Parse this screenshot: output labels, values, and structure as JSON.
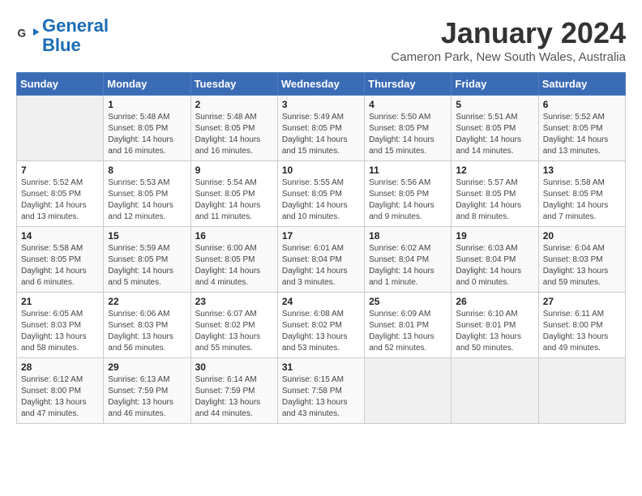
{
  "header": {
    "logo_line1": "General",
    "logo_line2": "Blue",
    "month": "January 2024",
    "location": "Cameron Park, New South Wales, Australia"
  },
  "weekdays": [
    "Sunday",
    "Monday",
    "Tuesday",
    "Wednesday",
    "Thursday",
    "Friday",
    "Saturday"
  ],
  "weeks": [
    [
      {
        "day": "",
        "info": ""
      },
      {
        "day": "1",
        "info": "Sunrise: 5:48 AM\nSunset: 8:05 PM\nDaylight: 14 hours\nand 16 minutes."
      },
      {
        "day": "2",
        "info": "Sunrise: 5:48 AM\nSunset: 8:05 PM\nDaylight: 14 hours\nand 16 minutes."
      },
      {
        "day": "3",
        "info": "Sunrise: 5:49 AM\nSunset: 8:05 PM\nDaylight: 14 hours\nand 15 minutes."
      },
      {
        "day": "4",
        "info": "Sunrise: 5:50 AM\nSunset: 8:05 PM\nDaylight: 14 hours\nand 15 minutes."
      },
      {
        "day": "5",
        "info": "Sunrise: 5:51 AM\nSunset: 8:05 PM\nDaylight: 14 hours\nand 14 minutes."
      },
      {
        "day": "6",
        "info": "Sunrise: 5:52 AM\nSunset: 8:05 PM\nDaylight: 14 hours\nand 13 minutes."
      }
    ],
    [
      {
        "day": "7",
        "info": "Sunrise: 5:52 AM\nSunset: 8:05 PM\nDaylight: 14 hours\nand 13 minutes."
      },
      {
        "day": "8",
        "info": "Sunrise: 5:53 AM\nSunset: 8:05 PM\nDaylight: 14 hours\nand 12 minutes."
      },
      {
        "day": "9",
        "info": "Sunrise: 5:54 AM\nSunset: 8:05 PM\nDaylight: 14 hours\nand 11 minutes."
      },
      {
        "day": "10",
        "info": "Sunrise: 5:55 AM\nSunset: 8:05 PM\nDaylight: 14 hours\nand 10 minutes."
      },
      {
        "day": "11",
        "info": "Sunrise: 5:56 AM\nSunset: 8:05 PM\nDaylight: 14 hours\nand 9 minutes."
      },
      {
        "day": "12",
        "info": "Sunrise: 5:57 AM\nSunset: 8:05 PM\nDaylight: 14 hours\nand 8 minutes."
      },
      {
        "day": "13",
        "info": "Sunrise: 5:58 AM\nSunset: 8:05 PM\nDaylight: 14 hours\nand 7 minutes."
      }
    ],
    [
      {
        "day": "14",
        "info": "Sunrise: 5:58 AM\nSunset: 8:05 PM\nDaylight: 14 hours\nand 6 minutes."
      },
      {
        "day": "15",
        "info": "Sunrise: 5:59 AM\nSunset: 8:05 PM\nDaylight: 14 hours\nand 5 minutes."
      },
      {
        "day": "16",
        "info": "Sunrise: 6:00 AM\nSunset: 8:05 PM\nDaylight: 14 hours\nand 4 minutes."
      },
      {
        "day": "17",
        "info": "Sunrise: 6:01 AM\nSunset: 8:04 PM\nDaylight: 14 hours\nand 3 minutes."
      },
      {
        "day": "18",
        "info": "Sunrise: 6:02 AM\nSunset: 8:04 PM\nDaylight: 14 hours\nand 1 minute."
      },
      {
        "day": "19",
        "info": "Sunrise: 6:03 AM\nSunset: 8:04 PM\nDaylight: 14 hours\nand 0 minutes."
      },
      {
        "day": "20",
        "info": "Sunrise: 6:04 AM\nSunset: 8:03 PM\nDaylight: 13 hours\nand 59 minutes."
      }
    ],
    [
      {
        "day": "21",
        "info": "Sunrise: 6:05 AM\nSunset: 8:03 PM\nDaylight: 13 hours\nand 58 minutes."
      },
      {
        "day": "22",
        "info": "Sunrise: 6:06 AM\nSunset: 8:03 PM\nDaylight: 13 hours\nand 56 minutes."
      },
      {
        "day": "23",
        "info": "Sunrise: 6:07 AM\nSunset: 8:02 PM\nDaylight: 13 hours\nand 55 minutes."
      },
      {
        "day": "24",
        "info": "Sunrise: 6:08 AM\nSunset: 8:02 PM\nDaylight: 13 hours\nand 53 minutes."
      },
      {
        "day": "25",
        "info": "Sunrise: 6:09 AM\nSunset: 8:01 PM\nDaylight: 13 hours\nand 52 minutes."
      },
      {
        "day": "26",
        "info": "Sunrise: 6:10 AM\nSunset: 8:01 PM\nDaylight: 13 hours\nand 50 minutes."
      },
      {
        "day": "27",
        "info": "Sunrise: 6:11 AM\nSunset: 8:00 PM\nDaylight: 13 hours\nand 49 minutes."
      }
    ],
    [
      {
        "day": "28",
        "info": "Sunrise: 6:12 AM\nSunset: 8:00 PM\nDaylight: 13 hours\nand 47 minutes."
      },
      {
        "day": "29",
        "info": "Sunrise: 6:13 AM\nSunset: 7:59 PM\nDaylight: 13 hours\nand 46 minutes."
      },
      {
        "day": "30",
        "info": "Sunrise: 6:14 AM\nSunset: 7:59 PM\nDaylight: 13 hours\nand 44 minutes."
      },
      {
        "day": "31",
        "info": "Sunrise: 6:15 AM\nSunset: 7:58 PM\nDaylight: 13 hours\nand 43 minutes."
      },
      {
        "day": "",
        "info": ""
      },
      {
        "day": "",
        "info": ""
      },
      {
        "day": "",
        "info": ""
      }
    ]
  ]
}
